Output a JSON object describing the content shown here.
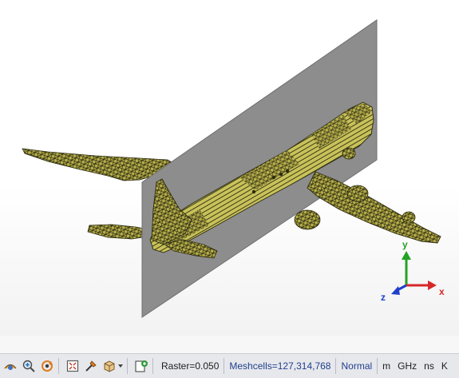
{
  "view": {
    "axes": {
      "x": "x",
      "y": "y",
      "z": "z"
    },
    "colors": {
      "mesh_fill": "#b8b04a",
      "mesh_line": "#2b2a10",
      "plane": "#8d8d8d",
      "axis_x": "#d62828",
      "axis_y": "#23a323",
      "axis_z": "#1f3fc9"
    }
  },
  "statusbar": {
    "tools": [
      "view-options-icon",
      "zoom-icon",
      "rotate-icon",
      "fit-view-icon",
      "pick-tool-icon",
      "box-view-icon",
      "export-icon"
    ],
    "raster": "Raster=0.050",
    "meshcells": "Meshcells=127,314,768",
    "mode": "Normal",
    "units": {
      "length": "m",
      "frequency": "GHz",
      "time": "ns",
      "temperature": "K"
    }
  }
}
